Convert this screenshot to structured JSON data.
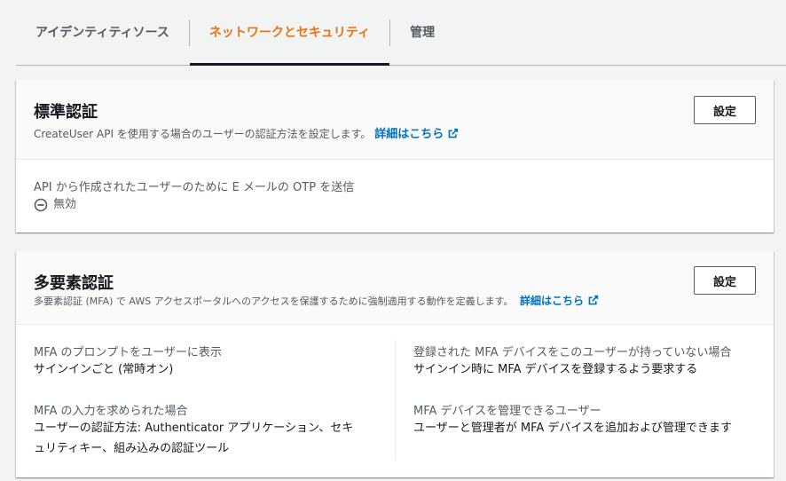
{
  "tabs": {
    "identity_source": "アイデンティティソース",
    "network_security": "ネットワークとセキュリティ",
    "management": "管理"
  },
  "standard_auth": {
    "title": "標準認証",
    "description": "CreateUser API を使用する場合のユーザーの認証方法を設定します。",
    "link": "詳細はこちら",
    "button": "設定",
    "otp_label": "API から作成されたユーザーのために E メールの OTP を送信",
    "otp_status": "無効"
  },
  "mfa": {
    "title": "多要素認証",
    "description": "多要素認証 (MFA) で AWS アクセスポータルへのアクセスを保護するために強制適用する動作を定義します。",
    "link": "詳細はこちら",
    "button": "設定",
    "prompt_label": "MFA のプロンプトをユーザーに表示",
    "prompt_value": "サインインごと (常時オン)",
    "no_device_label": "登録された MFA デバイスをこのユーザーが持っていない場合",
    "no_device_value": "サインイン時に MFA デバイスを登録するよう要求する",
    "input_label": "MFA の入力を求められた場合",
    "input_value_line1": "ユーザーの認証方法: Authenticator アプリケーション、セキ",
    "input_value_line2": "ュリティキー、組み込みの認証ツール",
    "manage_label": "MFA デバイスを管理できるユーザー",
    "manage_value": "ユーザーと管理者が MFA デバイスを追加および管理できます"
  },
  "colors": {
    "accent": "#ec7211",
    "link": "#0073bb"
  }
}
